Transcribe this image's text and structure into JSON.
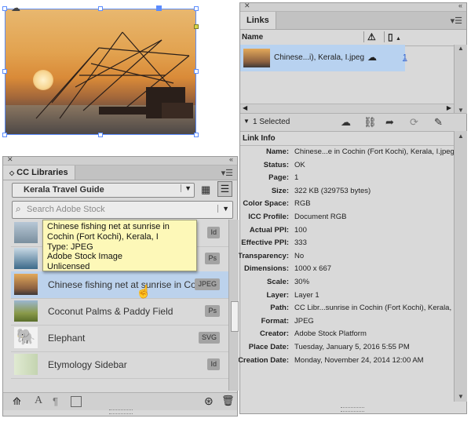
{
  "links_panel": {
    "tab_label": "Links",
    "column_name": "Name",
    "link_item": {
      "name": "Chinese...i), Kerala, I.jpeg",
      "page": "1"
    },
    "selected_count": "1 Selected",
    "link_info_label": "Link Info",
    "info": [
      {
        "key": "Name:",
        "value": "Chinese...e in Cochin (Fort Kochi), Kerala, I.jpeg"
      },
      {
        "key": "Status:",
        "value": "OK"
      },
      {
        "key": "Page:",
        "value": "1"
      },
      {
        "key": "Size:",
        "value": "322 KB (329753 bytes)"
      },
      {
        "key": "Color Space:",
        "value": "RGB"
      },
      {
        "key": "ICC Profile:",
        "value": "Document RGB"
      },
      {
        "key": "Actual PPI:",
        "value": "100"
      },
      {
        "key": "Effective PPI:",
        "value": "333"
      },
      {
        "key": "Transparency:",
        "value": "No"
      },
      {
        "key": "Dimensions:",
        "value": "1000 x 667"
      },
      {
        "key": "Scale:",
        "value": "30%"
      },
      {
        "key": "Layer:",
        "value": "Layer 1"
      },
      {
        "key": "Path:",
        "value": "CC Libr...sunrise in Cochin (Fort Kochi), Kerala, I"
      },
      {
        "key": "Format:",
        "value": "JPEG"
      },
      {
        "key": "Creator:",
        "value": "Adobe Stock Platform"
      },
      {
        "key": "Place Date:",
        "value": "Tuesday, January 5, 2016 5:55 PM"
      },
      {
        "key": "Creation Date:",
        "value": "Monday, November 24, 2014 12:00 AM"
      }
    ]
  },
  "libraries_panel": {
    "tab_label": "CC Libraries",
    "library_select": "Kerala Travel Guide",
    "search_placeholder": "Search Adobe Stock",
    "items": [
      {
        "name": "",
        "badge": "Id"
      },
      {
        "name": "",
        "badge": "Ps"
      },
      {
        "name": "Chinese fishing net at sunrise in Co...",
        "badge": "JPEG"
      },
      {
        "name": "Coconut Palms & Paddy Field",
        "badge": "Ps"
      },
      {
        "name": "Elephant",
        "badge": "SVG"
      },
      {
        "name": "Etymology Sidebar",
        "badge": "Id"
      }
    ],
    "tooltip": [
      "Chinese fishing net at sunrise in",
      "Cochin (Fort Kochi), Kerala, I",
      "Type: JPEG",
      "Adobe Stock Image",
      "Unlicensed"
    ]
  },
  "colors": {
    "panel_bg": "#d9d9d9",
    "selection_blue": "#b8d2f0",
    "handle_blue": "#5b8cff",
    "tooltip_bg": "#fdf8b8",
    "link_blue": "#2255cc"
  },
  "icons": [
    "cloud-icon",
    "warning-icon",
    "page-icon",
    "relink-cc-icon",
    "link-icon",
    "goto-link-icon",
    "update-icon",
    "edit-icon",
    "grid-view-icon",
    "list-view-icon",
    "search-icon",
    "elephant-icon",
    "trash-icon"
  ]
}
